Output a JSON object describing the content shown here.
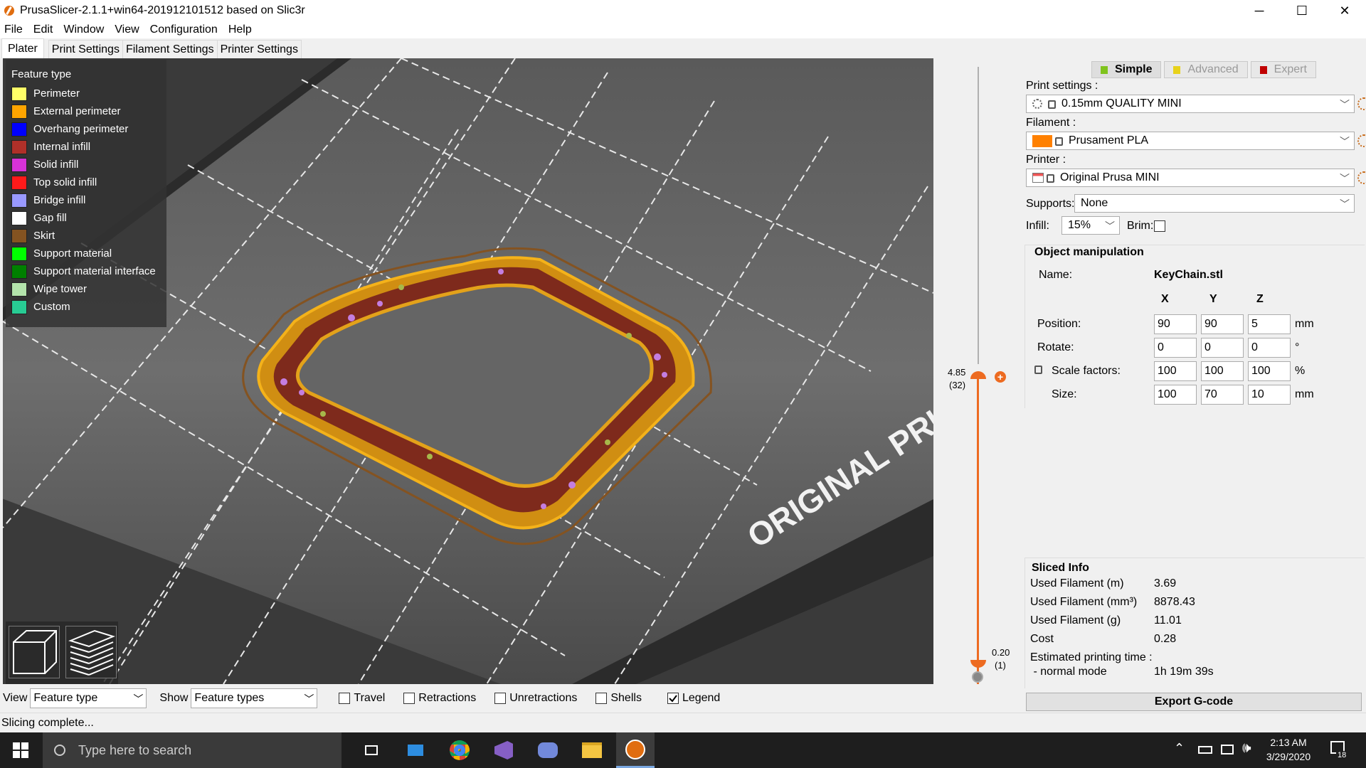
{
  "window": {
    "title": "PrusaSlicer-2.1.1+win64-201912101512 based on Slic3r",
    "controls": {
      "minimize": "─",
      "maximize": "☐",
      "close": "✕"
    }
  },
  "menu": [
    "File",
    "Edit",
    "Window",
    "View",
    "Configuration",
    "Help"
  ],
  "tabs": [
    "Plater",
    "Print Settings",
    "Filament Settings",
    "Printer Settings"
  ],
  "legend": {
    "title": "Feature type",
    "items": [
      {
        "label": "Perimeter",
        "color": "#ffff68"
      },
      {
        "label": "External perimeter",
        "color": "#ffa500"
      },
      {
        "label": "Overhang perimeter",
        "color": "#0000ff"
      },
      {
        "label": "Internal infill",
        "color": "#b03029"
      },
      {
        "label": "Solid infill",
        "color": "#d732d7"
      },
      {
        "label": "Top solid infill",
        "color": "#ff1a1a"
      },
      {
        "label": "Bridge infill",
        "color": "#9999ff"
      },
      {
        "label": "Gap fill",
        "color": "#ffffff"
      },
      {
        "label": "Skirt",
        "color": "#845321"
      },
      {
        "label": "Support material",
        "color": "#00ff00"
      },
      {
        "label": "Support material interface",
        "color": "#008000"
      },
      {
        "label": "Wipe tower",
        "color": "#b3e3ab"
      },
      {
        "label": "Custom",
        "color": "#28cc94"
      }
    ]
  },
  "bed_label": "ORIGINAL PRUSA",
  "layer_slider": {
    "top_value": "4.85",
    "top_layer": "(32)",
    "bottom_value": "0.20",
    "bottom_layer": "(1)",
    "accent": "#ed6b21"
  },
  "modes": [
    {
      "label": "Simple",
      "color": "#7fc31d",
      "active": true
    },
    {
      "label": "Advanced",
      "color": "#e8d21b",
      "active": false
    },
    {
      "label": "Expert",
      "color": "#c00000",
      "active": false
    }
  ],
  "print_settings": {
    "label": "Print settings :",
    "value": "0.15mm QUALITY MINI"
  },
  "filament": {
    "label": "Filament :",
    "value": "Prusament PLA",
    "color": "#ff8000"
  },
  "printer": {
    "label": "Printer :",
    "value": "Original Prusa MINI"
  },
  "supports": {
    "label": "Supports:",
    "value": "None"
  },
  "infill": {
    "label": "Infill:",
    "value": "15%"
  },
  "brim": {
    "label": "Brim:",
    "checked": false
  },
  "object_manipulation": {
    "title": "Object manipulation",
    "name_label": "Name:",
    "name_value": "KeyChain.stl",
    "axes": [
      "X",
      "Y",
      "Z"
    ],
    "rows": [
      {
        "label": "Position:",
        "values": [
          "90",
          "90",
          "5"
        ],
        "unit": "mm"
      },
      {
        "label": "Rotate:",
        "values": [
          "0",
          "0",
          "0"
        ],
        "unit": "°"
      },
      {
        "label": "Scale factors:",
        "values": [
          "100",
          "100",
          "100"
        ],
        "unit": "%"
      },
      {
        "label": "Size:",
        "values": [
          "100",
          "70",
          "10"
        ],
        "unit": "mm"
      }
    ]
  },
  "sliced_info": {
    "title": "Sliced Info",
    "rows": [
      {
        "label": "Used Filament (m)",
        "value": "3.69"
      },
      {
        "label": "Used Filament (mm³)",
        "value": "8878.43"
      },
      {
        "label": "Used Filament (g)",
        "value": "11.01"
      },
      {
        "label": "Cost",
        "value": "0.28"
      },
      {
        "label": "Estimated printing time :",
        "value": ""
      },
      {
        "label": " - normal mode",
        "value": "1h 19m 39s"
      }
    ]
  },
  "export_button": "Export G-code",
  "bottom": {
    "view_label": "View",
    "view_value": "Feature type",
    "show_label": "Show",
    "show_value": "Feature types",
    "checks": [
      {
        "label": "Travel",
        "checked": false
      },
      {
        "label": "Retractions",
        "checked": false
      },
      {
        "label": "Unretractions",
        "checked": false
      },
      {
        "label": "Shells",
        "checked": false
      },
      {
        "label": "Legend",
        "checked": true
      }
    ]
  },
  "status": "Slicing complete...",
  "taskbar": {
    "search_placeholder": "Type here to search",
    "time": "2:13 AM",
    "date": "3/29/2020",
    "notification_count": "18"
  }
}
